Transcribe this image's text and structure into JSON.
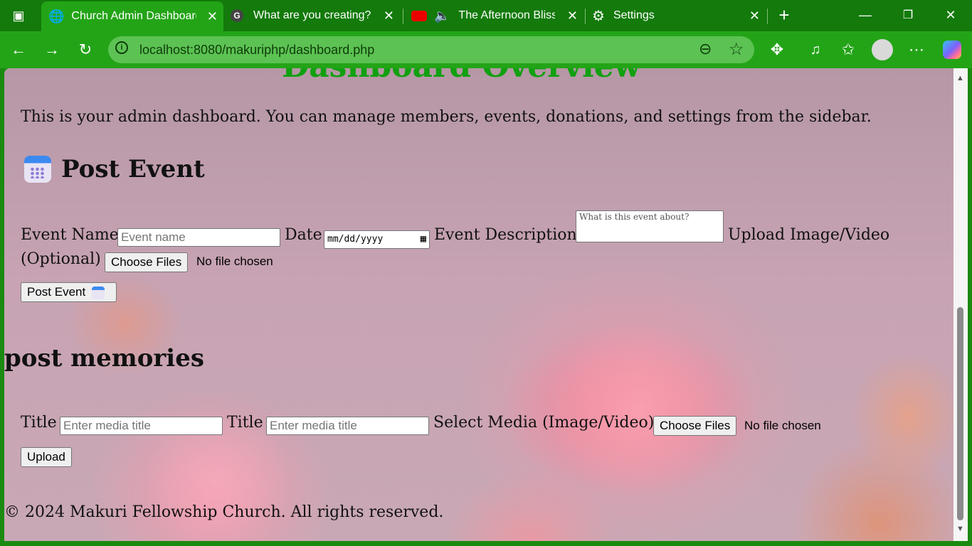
{
  "browser": {
    "tabs": [
      {
        "label": "Church Admin Dashboard",
        "icon": "globe-icon"
      },
      {
        "label": "What are you creating?",
        "icon": "g-logo-icon"
      },
      {
        "label": "The Afternoon Bliss",
        "icon": "youtube-icon"
      },
      {
        "label": "Settings",
        "icon": "gear-icon"
      }
    ],
    "close_glyph": "✕",
    "new_tab_glyph": "+",
    "address": "localhost:8080/makuriphp/dashboard.php"
  },
  "page": {
    "heading_top": "Dashboard Overview",
    "intro": "This is your admin dashboard. You can manage members, events, donations, and settings from the sidebar.",
    "post_event": {
      "heading": "Post Event",
      "event_name_label": "Event Name",
      "event_name_placeholder": "Event name",
      "date_label": "Date",
      "date_placeholder": "mm/dd/yyyy",
      "description_label": "Event Description",
      "description_placeholder": "What is this event about?",
      "upload_label_1": "Upload Image/Video",
      "upload_label_2": "(Optional)",
      "choose_files": "Choose Files",
      "no_file": "No file chosen",
      "submit": "Post Event"
    },
    "memories": {
      "heading": "post memories",
      "title_label_1": "Title",
      "title_placeholder_1": "Enter media title",
      "title_label_2": "Title",
      "title_placeholder_2": "Enter media title",
      "media_label": "Select Media (Image/Video)",
      "choose_files": "Choose Files",
      "no_file": "No file chosen",
      "submit": "Upload"
    },
    "footer": "© 2024 Makuri Fellowship Church. All rights reserved."
  }
}
